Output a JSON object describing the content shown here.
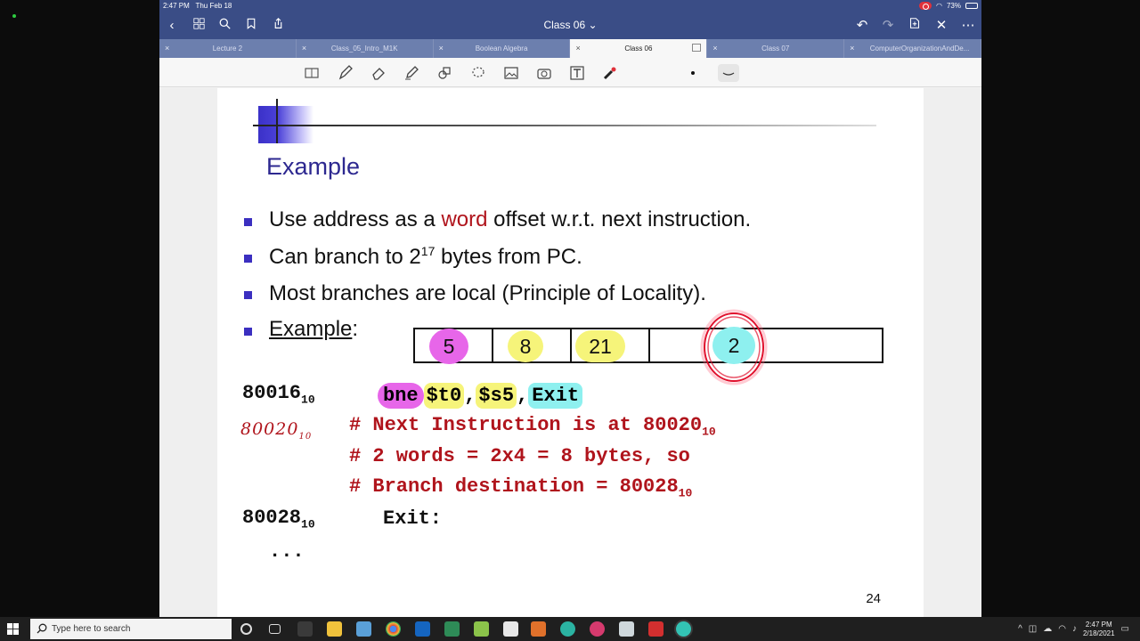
{
  "status_bar": {
    "time": "2:47 PM",
    "date": "Thu Feb 18",
    "battery": "73%"
  },
  "nav": {
    "doc_title": "Class 06 ⌄"
  },
  "tabs": [
    {
      "label": "Lecture 2",
      "active": false
    },
    {
      "label": "Class_05_Intro_M1K",
      "active": false
    },
    {
      "label": "Boolean Algebra",
      "active": false
    },
    {
      "label": "Class 06",
      "active": true
    },
    {
      "label": "Class 07",
      "active": false
    },
    {
      "label": "ComputerOrganizationAndDe...",
      "active": false
    }
  ],
  "slide": {
    "title": "Example",
    "bullets": {
      "b1_pre": "Use address as a ",
      "b1_word": "word",
      "b1_post": " offset w.r.t. next instruction.",
      "b2_pre": "Can branch to 2",
      "b2_sup": "17",
      "b2_post": " bytes from PC.",
      "b3": "Most branches are local (Principle of Locality).",
      "b4_link": "Example",
      "b4_colon": ":"
    },
    "instr_fields": [
      "5",
      "8",
      "21",
      "2"
    ],
    "addr1": "80016",
    "addr1_sub": "10",
    "asm": {
      "op": "bne",
      "r1": "$t0",
      "comma1": ",",
      "r2": "$s5",
      "comma2": ",",
      "label": "Exit"
    },
    "hand_note": "80020",
    "hand_note_sub": "10",
    "comment1": "# Next Instruction is at 80020",
    "comment1_sub": "10",
    "comment2": "# 2 words = 2x4 = 8 bytes, so",
    "comment3": "# Branch destination = 80028",
    "comment3_sub": "10",
    "addr2": "80028",
    "addr2_sub": "10",
    "exit_label": "Exit:",
    "ellipsis": "...",
    "page_number": "24"
  },
  "taskbar": {
    "search_placeholder": "Type here to search",
    "clock_time": "2:47 PM",
    "clock_date": "2/18/2021"
  },
  "colors": {
    "accent": "#3a4d86",
    "highlight_pink": "#e766e9",
    "highlight_yellow": "#f6f47a",
    "highlight_cyan": "#8ef0ef",
    "comment_red": "#b0141c"
  }
}
